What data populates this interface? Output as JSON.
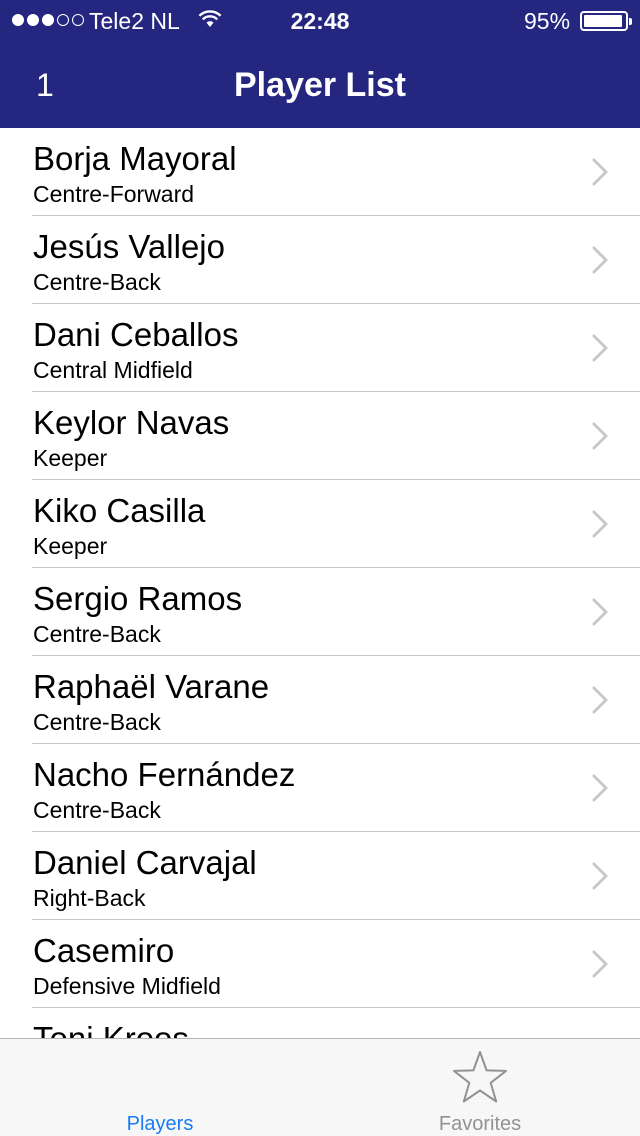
{
  "status_bar": {
    "carrier": "Tele2 NL",
    "time": "22:48",
    "battery_percent": "95%",
    "signal_bars_filled": 3,
    "signal_bars_total": 5,
    "icons": [
      "signal-dots-icon",
      "wifi-icon",
      "battery-icon"
    ]
  },
  "nav": {
    "left_text": "1",
    "title": "Player List"
  },
  "players": [
    {
      "name": "Borja Mayoral",
      "position": "Centre-Forward"
    },
    {
      "name": "Jesús Vallejo",
      "position": "Centre-Back"
    },
    {
      "name": "Dani Ceballos",
      "position": "Central Midfield"
    },
    {
      "name": "Keylor Navas",
      "position": "Keeper"
    },
    {
      "name": "Kiko Casilla",
      "position": "Keeper"
    },
    {
      "name": "Sergio Ramos",
      "position": "Centre-Back"
    },
    {
      "name": "Raphaël Varane",
      "position": "Centre-Back"
    },
    {
      "name": "Nacho Fernández",
      "position": "Centre-Back"
    },
    {
      "name": "Daniel Carvajal",
      "position": "Right-Back"
    },
    {
      "name": "Casemiro",
      "position": "Defensive Midfield"
    },
    {
      "name": "Toni Kroos",
      "position": ""
    }
  ],
  "tabs": [
    {
      "label": "Players",
      "selected": true
    },
    {
      "label": "Favorites",
      "selected": false,
      "icon": "star-icon"
    }
  ],
  "colors": {
    "nav_background": "#25267f",
    "tab_selected": "#1a7cf4",
    "tab_unselected": "#929292",
    "chevron": "#c7c7cc"
  }
}
